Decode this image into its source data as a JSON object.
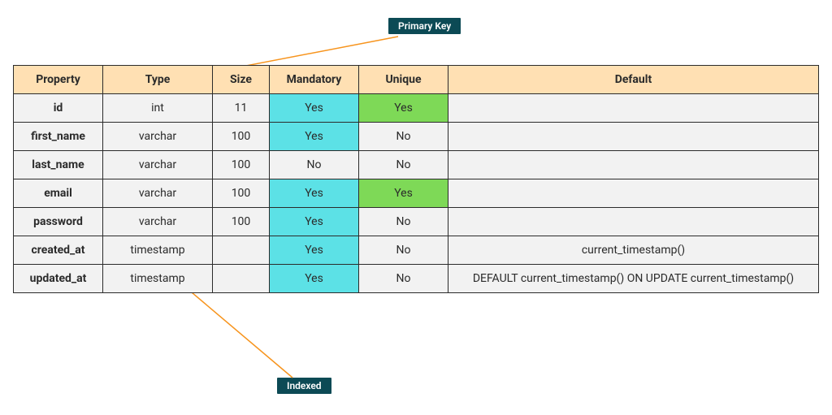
{
  "headers": {
    "property": "Property",
    "type": "Type",
    "size": "Size",
    "mandatory": "Mandatory",
    "unique": "Unique",
    "default": "Default"
  },
  "rows": [
    {
      "property": "id",
      "type": "int",
      "size": "11",
      "mandatory": "Yes",
      "unique": "Yes",
      "default": ""
    },
    {
      "property": "first_name",
      "type": "varchar",
      "size": "100",
      "mandatory": "Yes",
      "unique": "No",
      "default": ""
    },
    {
      "property": "last_name",
      "type": "varchar",
      "size": "100",
      "mandatory": "No",
      "unique": "No",
      "default": ""
    },
    {
      "property": "email",
      "type": "varchar",
      "size": "100",
      "mandatory": "Yes",
      "unique": "Yes",
      "default": ""
    },
    {
      "property": "password",
      "type": "varchar",
      "size": "100",
      "mandatory": "Yes",
      "unique": "No",
      "default": ""
    },
    {
      "property": "created_at",
      "type": "timestamp",
      "size": "",
      "mandatory": "Yes",
      "unique": "No",
      "default": "current_timestamp()"
    },
    {
      "property": "updated_at",
      "type": "timestamp",
      "size": "",
      "mandatory": "Yes",
      "unique": "No",
      "default": "DEFAULT current_timestamp() ON UPDATE current_timestamp()"
    }
  ],
  "annotations": {
    "primary_key": "Primary Key",
    "indexed": "Indexed"
  }
}
